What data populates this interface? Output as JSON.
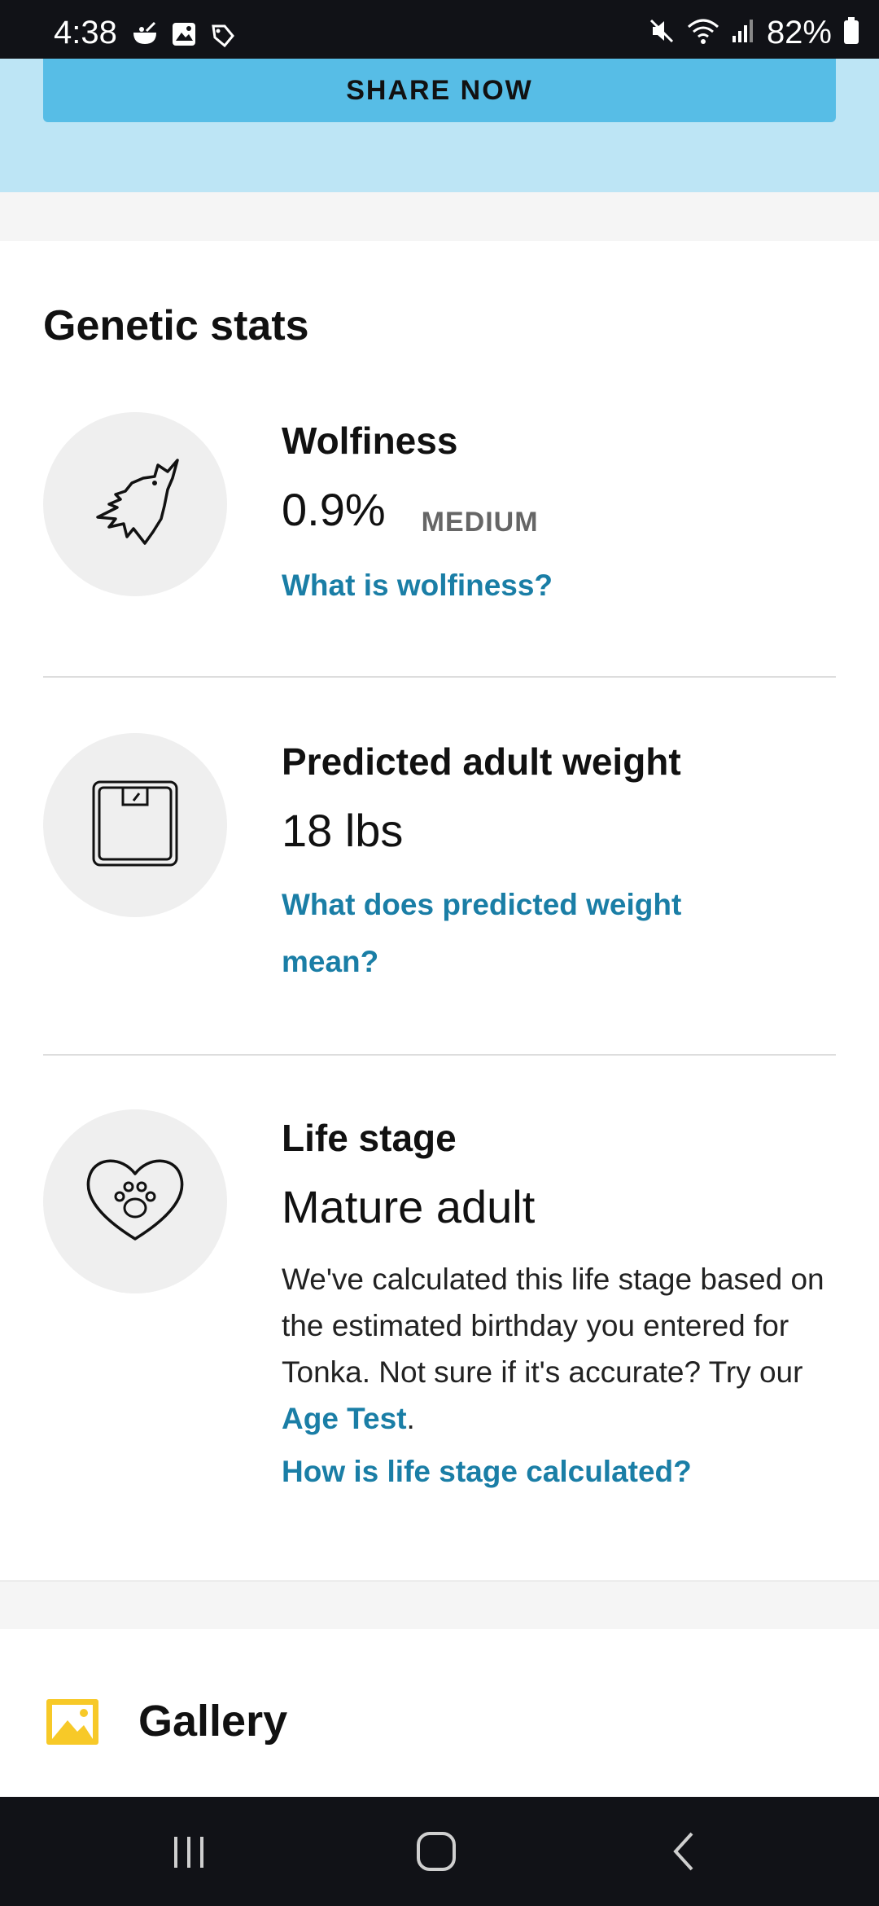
{
  "status_bar": {
    "time": "4:38",
    "battery": "82%",
    "left_icons": [
      "food-bowl-icon",
      "gallery-notification-icon",
      "pet-tag-icon"
    ],
    "right_icons": [
      "mute-icon",
      "wifi-icon",
      "signal-icon",
      "battery-icon"
    ]
  },
  "banner": {
    "share_label": "SHARE NOW"
  },
  "genetic_stats": {
    "title": "Genetic stats",
    "wolfiness": {
      "label": "Wolfiness",
      "value": "0.9%",
      "level": "MEDIUM",
      "link": "What is wolfiness?",
      "icon": "wolf-icon"
    },
    "weight": {
      "label": "Predicted adult weight",
      "value": "18 lbs",
      "link": "What does predicted weight mean?",
      "icon": "scale-icon"
    },
    "life_stage": {
      "label": "Life stage",
      "value": "Mature adult",
      "description": "We've calculated this life stage based on the estimated birthday you entered for Tonka. Not sure if it's accurate? Try our",
      "age_test_link": "Age Test",
      "description_end": ".",
      "link": "How is life stage calculated?",
      "icon": "paw-heart-icon"
    }
  },
  "gallery": {
    "title": "Gallery",
    "icon": "image-icon",
    "icon_color": "#f7c928"
  },
  "nav_bar": {
    "buttons": [
      "recent-apps-icon",
      "home-icon",
      "back-icon"
    ]
  },
  "colors": {
    "accent_link": "#1a7ea6",
    "share_button": "#57bde6",
    "banner_bg": "#bde5f5"
  }
}
